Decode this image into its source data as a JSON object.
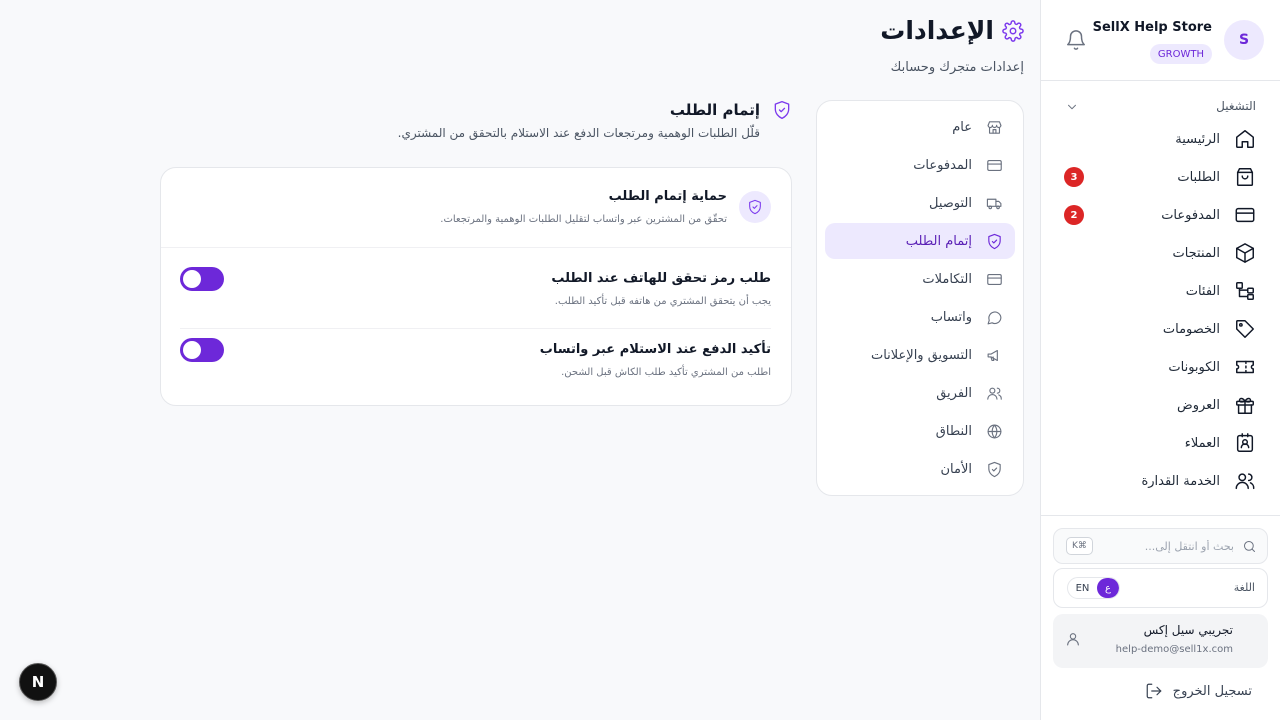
{
  "store": {
    "avatar_letter": "S",
    "name": "SellX Help Store",
    "plan": "GROWTH"
  },
  "sidebar": {
    "section_label": "التشغيل",
    "items": [
      {
        "label": "الرئيسية",
        "icon": "home-icon"
      },
      {
        "label": "الطلبات",
        "icon": "shopping-bag-icon",
        "badge": "3"
      },
      {
        "label": "المدفوعات",
        "icon": "credit-card-icon",
        "badge": "2"
      },
      {
        "label": "المنتجات",
        "icon": "box-icon"
      },
      {
        "label": "الفئات",
        "icon": "categories-icon"
      },
      {
        "label": "الخصومات",
        "icon": "tag-icon"
      },
      {
        "label": "الكوبونات",
        "icon": "ticket-icon"
      },
      {
        "label": "العروض",
        "icon": "gift-icon"
      },
      {
        "label": "العملاء",
        "icon": "contact-icon"
      },
      {
        "label": "الخدمة القدارة",
        "icon": "users-icon"
      }
    ],
    "search_placeholder": "بحث أو انتقل إلى...",
    "search_shortcut": "K⌘",
    "language_label": "اللغة",
    "language_options": [
      "EN",
      "ع"
    ],
    "language_active": "ع",
    "user_name": "تجريبي سيل إكس",
    "user_email": "help-demo@sell1x.com",
    "logout_label": "تسجيل الخروج"
  },
  "page": {
    "title": "الإعدادات",
    "subtitle": "إعدادات متجرك وحسابك"
  },
  "settings_nav": {
    "items": [
      {
        "label": "عام",
        "icon": "store-icon"
      },
      {
        "label": "المدفوعات",
        "icon": "credit-card-icon"
      },
      {
        "label": "التوصيل",
        "icon": "truck-icon"
      },
      {
        "label": "إتمام الطلب",
        "icon": "shield-check-icon",
        "active": true
      },
      {
        "label": "التكاملات",
        "icon": "credit-card-icon"
      },
      {
        "label": "واتساب",
        "icon": "chat-icon"
      },
      {
        "label": "التسويق والإعلانات",
        "icon": "megaphone-icon"
      },
      {
        "label": "الفريق",
        "icon": "users-icon"
      },
      {
        "label": "النطاق",
        "icon": "globe-icon"
      },
      {
        "label": "الأمان",
        "icon": "shield-check-icon"
      }
    ]
  },
  "section": {
    "title": "إتمام الطلب",
    "subtitle": "قلّل الطلبات الوهمية ومرتجعات الدفع عند الاستلام بالتحقق من المشتري."
  },
  "card": {
    "title": "حماية إتمام الطلب",
    "description": "تحقّق من المشترين عبر واتساب لتقليل الطلبات الوهمية والمرتجعات.",
    "rows": [
      {
        "title": "طلب رمز تحقق للهاتف عند الطلب",
        "description": "يجب أن يتحقق المشتري من هاتفه قبل تأكيد الطلب.",
        "enabled": true
      },
      {
        "title": "تأكيد الدفع عند الاستلام عبر واتساب",
        "description": "اطلب من المشتري تأكيد طلب الكاش قبل الشحن.",
        "enabled": true
      }
    ]
  },
  "dev_badge": "N"
}
